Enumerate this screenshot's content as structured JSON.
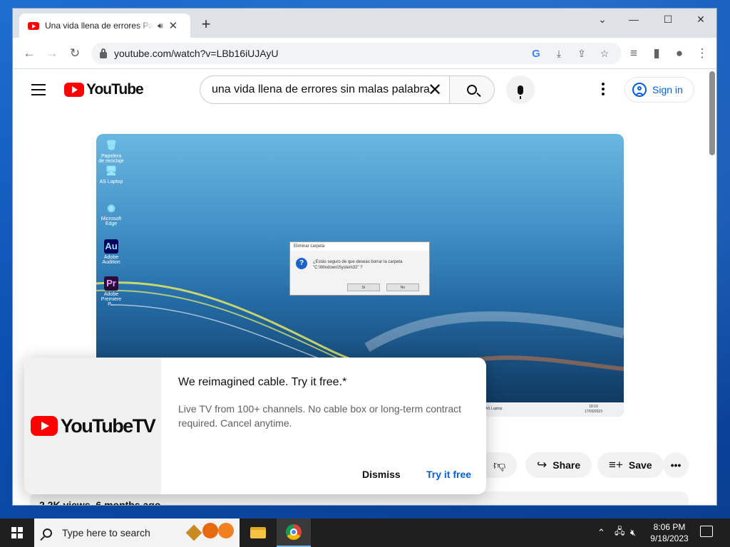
{
  "browser": {
    "tab": {
      "title": "Una vida llena de errores Par"
    },
    "address": {
      "url": "youtube.com/watch?v=LBb16iUJAyU"
    }
  },
  "youtube": {
    "logo_text": "YouTube",
    "search": {
      "value": "una vida llena de errores sin malas palabras"
    },
    "sign_in": "Sign in",
    "actions": {
      "share": "Share",
      "save": "Save"
    },
    "meta": {
      "views": "2.2K views",
      "age": "6 months ago"
    }
  },
  "video_frame": {
    "desktop_icons": [
      "Papelera de reciclaje",
      "AS Laptop",
      "Microsoft Edge",
      "Adobe Audition",
      "Adobe Premiere P..."
    ],
    "dialog_title": "Eliminar carpeta",
    "dialog_message": "¿Estás seguro de que deseas borrar la carpeta \"C:\\Windows\\System32\" ?",
    "dialog_yes": "Sí",
    "dialog_no": "No",
    "taskbar_label": "AS Laptop",
    "taskbar_time": "18:10",
    "taskbar_date": "17/03/2023"
  },
  "promo": {
    "logo_text": "YouTubeTV",
    "title": "We reimagined cable. Try it free.*",
    "description": "Live TV from 100+ channels. No cable box or long-term contract required. Cancel anytime.",
    "dismiss": "Dismiss",
    "try": "Try it free"
  },
  "taskbar": {
    "search_placeholder": "Type here to search",
    "time": "8:06 PM",
    "date": "9/18/2023"
  },
  "colors": {
    "youtube_red": "#ff0000",
    "link_blue": "#065fd4",
    "taskbar": "#1f1f1f"
  }
}
